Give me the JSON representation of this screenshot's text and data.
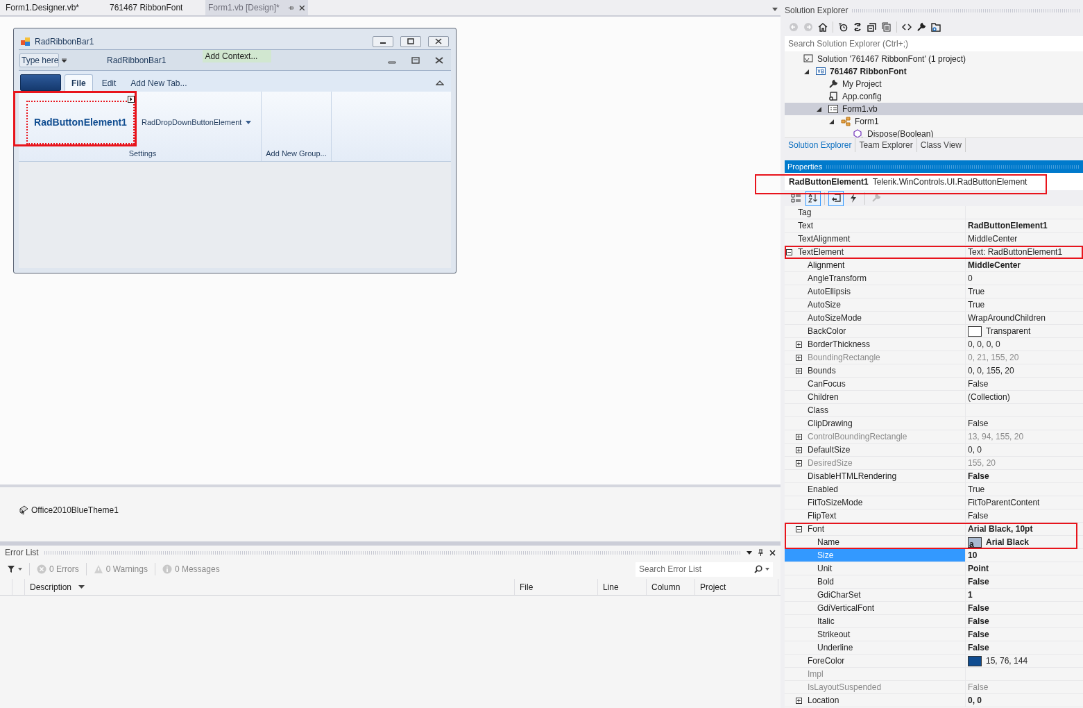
{
  "document_tabs": [
    {
      "label": "Form1.Designer.vb*",
      "selected": false
    },
    {
      "label": "761467 RibbonFont",
      "selected": false
    },
    {
      "label": "Form1.vb [Design]*",
      "selected": true
    }
  ],
  "designer": {
    "form_title": "RadRibbonBar1",
    "quick_access_placeholder": "Type here",
    "ribbon_title": "RadRibbonBar1",
    "context_button": "Add Context...",
    "ribbon_tabs": [
      {
        "label": "File",
        "selected": true
      },
      {
        "label": "Edit",
        "selected": false
      },
      {
        "label": "Add New Tab...",
        "selected": false
      }
    ],
    "button_element": {
      "label": "RadButtonElement1",
      "selected": true
    },
    "dropdown_element": "RadDropDownButtonElement",
    "groups": [
      "Settings",
      "Add New Group..."
    ]
  },
  "component_tray": [
    "Office2010BlueTheme1"
  ],
  "error_list": {
    "title": "Error List",
    "filters": [
      "0 Errors",
      "0 Warnings",
      "0 Messages"
    ],
    "search_placeholder": "Search Error List",
    "columns": [
      "Description",
      "File",
      "Line",
      "Column",
      "Project"
    ]
  },
  "solution_explorer": {
    "title": "Solution Explorer",
    "search_placeholder": "Search Solution Explorer (Ctrl+;)",
    "tree": [
      {
        "label": "Solution '761467 RibbonFont' (1 project)",
        "kind": "solution",
        "selected": false,
        "children": [
          {
            "label": "761467 RibbonFont",
            "kind": "project",
            "bold": true,
            "expanded": true,
            "selected": false,
            "children": [
              {
                "label": "My Project",
                "kind": "settings",
                "selected": false
              },
              {
                "label": "App.config",
                "kind": "config",
                "selected": false
              },
              {
                "label": "Form1.vb",
                "kind": "form",
                "expanded": true,
                "selected": true,
                "children": [
                  {
                    "label": "Form1",
                    "kind": "class",
                    "expanded": true,
                    "selected": false,
                    "children": [
                      {
                        "label": "Dispose(Boolean)",
                        "kind": "method",
                        "selected": false
                      }
                    ]
                  }
                ]
              }
            ]
          }
        ]
      }
    ],
    "tabs": [
      {
        "label": "Solution Explorer",
        "selected": true
      },
      {
        "label": "Team Explorer",
        "selected": false
      },
      {
        "label": "Class View",
        "selected": false
      }
    ]
  },
  "properties": {
    "title": "Properties",
    "object_name": "RadButtonElement1",
    "object_type": "Telerik.WinControls.UI.RadButtonElement",
    "rows": [
      {
        "name": "Tag",
        "selected": false
      },
      {
        "name": "Text",
        "value": "RadButtonElement1",
        "value_bold": true,
        "selected": false
      },
      {
        "name": "TextAlignment",
        "value": "MiddleCenter",
        "selected": false
      },
      {
        "name": "TextElement",
        "value": "Text: RadButtonElement1",
        "expanded": true,
        "selected": false,
        "children": [
          {
            "name": "Alignment",
            "value": "MiddleCenter",
            "value_bold": true,
            "selected": false
          },
          {
            "name": "AngleTransform",
            "value": "0",
            "selected": false
          },
          {
            "name": "AutoEllipsis",
            "value": "True",
            "selected": false
          },
          {
            "name": "AutoSize",
            "value": "True",
            "selected": false
          },
          {
            "name": "AutoSizeMode",
            "value": "WrapAroundChildren",
            "selected": false
          },
          {
            "name": "BackColor",
            "value": "Transparent",
            "color": "#ffffff",
            "selected": false
          },
          {
            "name": "BorderThickness",
            "value": "0, 0, 0, 0",
            "expanded": false,
            "selected": false
          },
          {
            "name": "BoundingRectangle",
            "value": "0, 21, 155, 20",
            "expanded": false,
            "dimmed": true,
            "selected": false
          },
          {
            "name": "Bounds",
            "value": "0, 0, 155, 20",
            "expanded": false,
            "selected": false
          },
          {
            "name": "CanFocus",
            "value": "False",
            "selected": false
          },
          {
            "name": "Children",
            "value": "(Collection)",
            "selected": false
          },
          {
            "name": "Class",
            "selected": false
          },
          {
            "name": "ClipDrawing",
            "value": "False",
            "selected": false
          },
          {
            "name": "ControlBoundingRectangle",
            "value": "13, 94, 155, 20",
            "expanded": false,
            "dimmed": true,
            "selected": false
          },
          {
            "name": "DefaultSize",
            "value": "0, 0",
            "expanded": false,
            "selected": false
          },
          {
            "name": "DesiredSize",
            "value": "155, 20",
            "expanded": false,
            "dimmed": true,
            "selected": false
          },
          {
            "name": "DisableHTMLRendering",
            "value": "False",
            "value_bold": true,
            "selected": false
          },
          {
            "name": "Enabled",
            "value": "True",
            "selected": false
          },
          {
            "name": "FitToSizeMode",
            "value": "FitToParentContent",
            "selected": false
          },
          {
            "name": "FlipText",
            "value": "False",
            "selected": false
          },
          {
            "name": "Font",
            "value": "Arial Black, 10pt",
            "value_bold": true,
            "expanded": true,
            "selected": false,
            "children": [
              {
                "name": "Name",
                "value": "Arial Black",
                "value_bold": true,
                "preview": "a",
                "selected": false
              },
              {
                "name": "Size",
                "value": "10",
                "value_bold": true,
                "selected": true
              },
              {
                "name": "Unit",
                "value": "Point",
                "value_bold": true,
                "selected": false
              },
              {
                "name": "Bold",
                "value": "False",
                "value_bold": true,
                "selected": false
              },
              {
                "name": "GdiCharSet",
                "value": "1",
                "value_bold": true,
                "selected": false
              },
              {
                "name": "GdiVerticalFont",
                "value": "False",
                "value_bold": true,
                "selected": false
              },
              {
                "name": "Italic",
                "value": "False",
                "value_bold": true,
                "selected": false
              },
              {
                "name": "Strikeout",
                "value": "False",
                "value_bold": true,
                "selected": false
              },
              {
                "name": "Underline",
                "value": "False",
                "value_bold": true,
                "selected": false
              }
            ]
          },
          {
            "name": "ForeColor",
            "value": "15, 76, 144",
            "color": "#0f4c90",
            "selected": false
          },
          {
            "name": "Impl",
            "dimmed": true,
            "selected": false
          },
          {
            "name": "IsLayoutSuspended",
            "value": "False",
            "dimmed": true,
            "selected": false
          },
          {
            "name": "Location",
            "value": "0, 0",
            "value_bold": true,
            "expanded": false,
            "selected": false
          }
        ]
      }
    ]
  }
}
